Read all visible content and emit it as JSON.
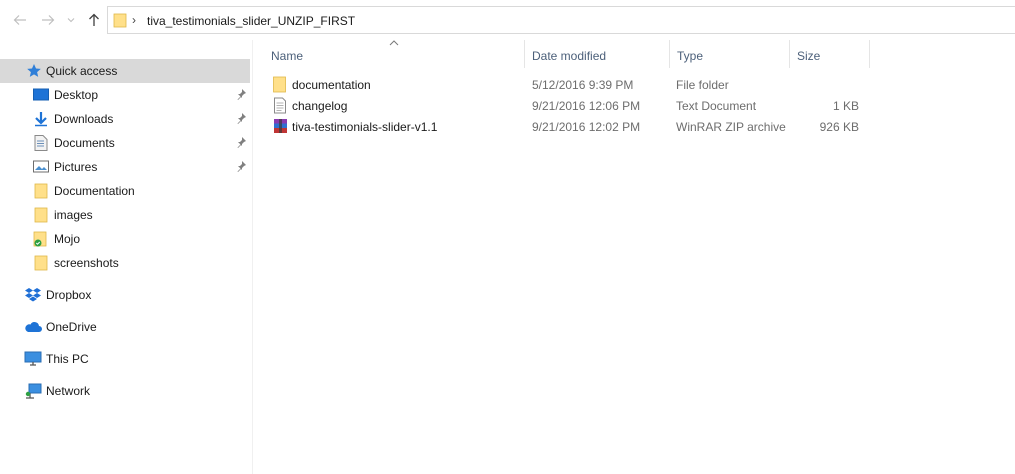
{
  "address": {
    "path": "tiva_testimonials_slider_UNZIP_FIRST"
  },
  "sidebar": {
    "quick_access": "Quick access",
    "pinned": [
      {
        "label": "Desktop",
        "icon": "desktop-icon"
      },
      {
        "label": "Downloads",
        "icon": "downloads-icon"
      },
      {
        "label": "Documents",
        "icon": "documents-icon"
      },
      {
        "label": "Pictures",
        "icon": "pictures-icon"
      }
    ],
    "recent": [
      {
        "label": "Documentation",
        "icon": "folder-icon"
      },
      {
        "label": "images",
        "icon": "folder-icon"
      },
      {
        "label": "Mojo",
        "icon": "folder-synced-icon"
      },
      {
        "label": "screenshots",
        "icon": "folder-icon"
      }
    ],
    "dropbox": "Dropbox",
    "onedrive": "OneDrive",
    "thispc": "This PC",
    "network": "Network"
  },
  "columns": {
    "name": "Name",
    "date": "Date modified",
    "type": "Type",
    "size": "Size"
  },
  "files": [
    {
      "name": "documentation",
      "date": "5/12/2016 9:39 PM",
      "type": "File folder",
      "size": "",
      "icon": "folder-icon"
    },
    {
      "name": "changelog",
      "date": "9/21/2016 12:06 PM",
      "type": "Text Document",
      "size": "1 KB",
      "icon": "text-file-icon"
    },
    {
      "name": "tiva-testimonials-slider-v1.1",
      "date": "9/21/2016 12:02 PM",
      "type": "WinRAR ZIP archive",
      "size": "926 KB",
      "icon": "winrar-icon"
    }
  ],
  "colors": {
    "sidebar_selected": "#d9d9d9",
    "header_text": "#4c607a",
    "folder": "#ffd96b",
    "accent": "#1e73d6"
  }
}
